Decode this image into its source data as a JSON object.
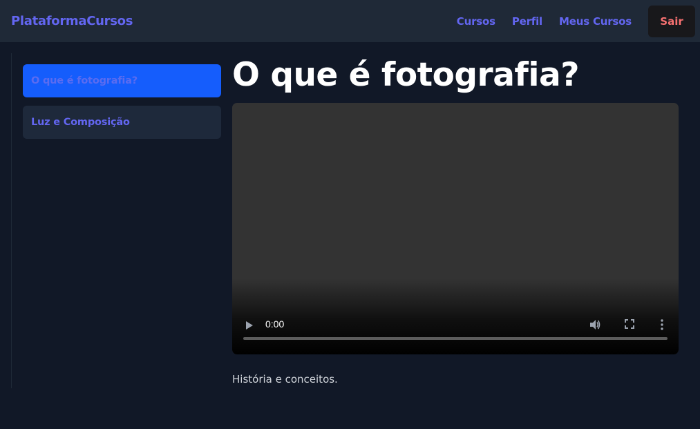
{
  "navbar": {
    "brand": "PlataformaCursos",
    "links": [
      {
        "label": "Cursos"
      },
      {
        "label": "Perfil"
      },
      {
        "label": "Meus Cursos"
      }
    ],
    "logout_label": "Sair"
  },
  "sidebar": {
    "lessons": [
      {
        "label": "O que é fotografia?",
        "active": true
      },
      {
        "label": "Luz e Composição",
        "active": false
      }
    ]
  },
  "main": {
    "title": "O que é fotografia?",
    "video": {
      "time": "0:00",
      "progress": 0,
      "icons": [
        "play-icon",
        "volume-icon",
        "fullscreen-icon",
        "more-options-icon"
      ]
    },
    "description": "História e conceitos."
  },
  "colors": {
    "page_bg": "#111827",
    "navbar_bg": "#1f2937",
    "accent": "#6366f1",
    "active_lesson_bg": "#155dfc",
    "inactive_lesson_bg": "#1e293b",
    "logout_text": "#f87171"
  }
}
